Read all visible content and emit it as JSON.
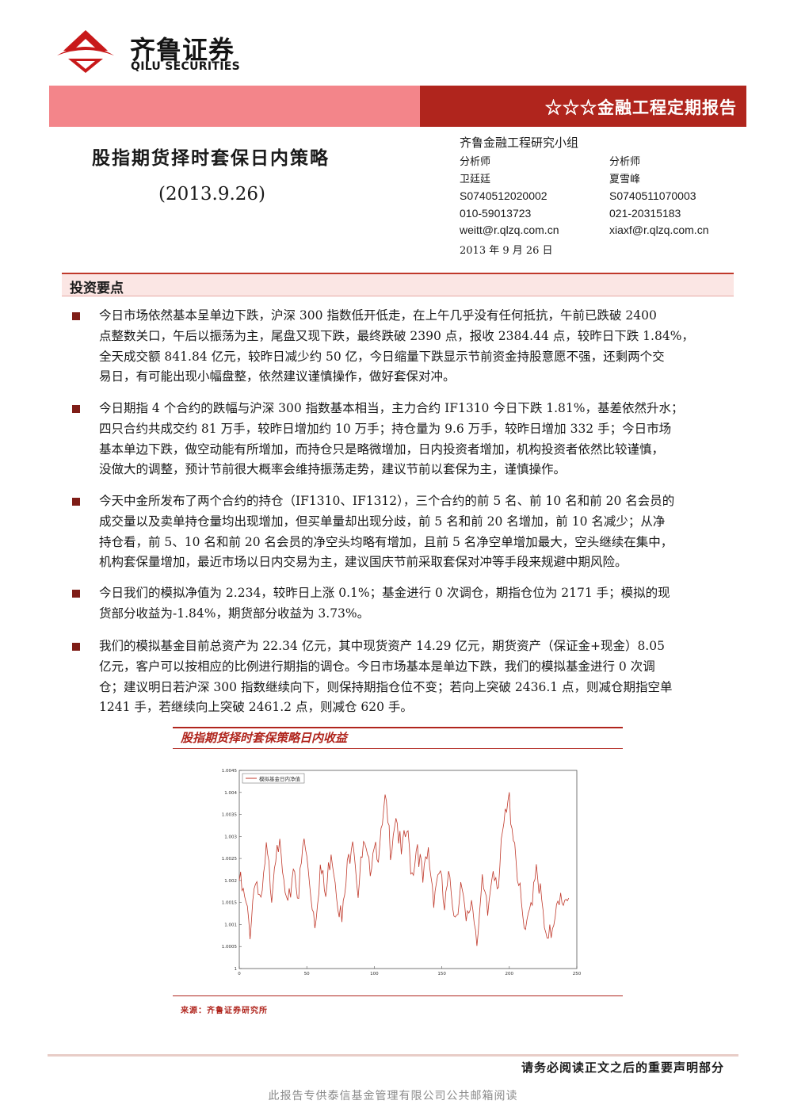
{
  "header": {
    "logo_cn": "齐鲁证券",
    "logo_en": "QILU SECURITIES",
    "banner": "☆☆☆金融工程定期报告"
  },
  "report": {
    "title": "股指期货择时套保日内策略",
    "date": "(2013.9.26)",
    "team": "齐鲁金融工程研究小组",
    "analysts": [
      {
        "role": "分析师",
        "name": "卫廷廷",
        "cert": "S0740512020002",
        "phone": "010-59013723",
        "email": "weitt@r.qlzq.com.cn"
      },
      {
        "role": "分析师",
        "name": "夏雪峰",
        "cert": "S0740511070003",
        "phone": "021-20315183",
        "email": "xiaxf@r.qlzq.com.cn"
      }
    ],
    "pub_date": "2013 年 9 月 26 日"
  },
  "section": {
    "title": "投资要点",
    "paragraphs": [
      [
        "今日市场依然基本呈单边下跌，沪深 300 指数低开低走，在上午几乎没有任何抵抗，午前已跌破 2400",
        "点整数关口，午后以振荡为主，尾盘又现下跌，最终跌破 2390 点，报收 2384.44 点，较昨日下跌 1.84%，",
        "全天成交额 841.84 亿元，较昨日减少约 50 亿，今日缩量下跌显示节前资金持股意愿不强，还剩两个交",
        "易日，有可能出现小幅盘整，依然建议谨慎操作，做好套保对冲。"
      ],
      [
        "今日期指 4 个合约的跌幅与沪深 300 指数基本相当，主力合约 IF1310 今日下跌 1.81%，基差依然升水；",
        "四只合约共成交约 81 万手，较昨日增加约 10 万手；持仓量为 9.6 万手，较昨日增加 332 手；今日市场",
        "基本单边下跌，做空动能有所增加，而持仓只是略微增加，日内投资者增加，机构投资者依然比较谨慎，",
        "没做大的调整，预计节前很大概率会维持振荡走势，建议节前以套保为主，谨慎操作。"
      ],
      [
        "今天中金所发布了两个合约的持仓（IF1310、IF1312），三个合约的前 5 名、前 10 名和前 20 名会员的",
        "成交量以及卖单持仓量均出现增加，但买单量却出现分歧，前 5 名和前 20 名增加，前 10 名减少；从净",
        "持仓看，前 5、10 名和前 20 名会员的净空头均略有增加，且前 5 名净空单增加最大，空头继续在集中，",
        "机构套保量增加，最近市场以日内交易为主，建议国庆节前采取套保对冲等手段来规避中期风险。"
      ],
      [
        "今日我们的模拟净值为 2.234，较昨日上涨 0.1%；基金进行 0 次调仓，期指仓位为 2171 手；模拟的现",
        "货部分收益为-1.84%，期货部分收益为 3.73%。"
      ],
      [
        "我们的模拟基金目前总资产为 22.34 亿元，其中现货资产 14.29 亿元，期货资产（保证金+现金）8.05",
        "亿元，客户可以按相应的比例进行期指的调仓。今日市场基本是单边下跌，我们的模拟基金进行 0 次调",
        "仓；建议明日若沪深 300 指数继续向下，则保持期指仓位不变；若向上突破 2436.1 点，则减仓期指空单",
        "1241 手，若继续向上突破 2461.2 点，则减仓 620 手。"
      ]
    ]
  },
  "chart": {
    "title": "股指期货择时套保策略日内收益",
    "source": "来源：齐鲁证券研究所"
  },
  "chart_data": {
    "type": "line",
    "legend": "模拟基金日内净值",
    "legend_position": "top-left",
    "xlim": [
      0,
      250
    ],
    "ylim": [
      1.0,
      1.0045
    ],
    "x_ticks": [
      "0",
      "50",
      "100",
      "150",
      "200",
      "250"
    ],
    "y_ticks": [
      "1",
      "1.0005",
      "1.001",
      "1.0015",
      "1.002",
      "1.0025",
      "1.003",
      "1.0035",
      "1.004",
      "1.0045"
    ],
    "color": "#c0392b",
    "series": [
      {
        "name": "模拟基金日内净值",
        "anchors": [
          [
            0,
            1.002
          ],
          [
            4,
            1.0015
          ],
          [
            8,
            1.0009
          ],
          [
            12,
            1.0022
          ],
          [
            16,
            1.0013
          ],
          [
            20,
            1.0026
          ],
          [
            24,
            1.0018
          ],
          [
            28,
            1.0031
          ],
          [
            32,
            1.0021
          ],
          [
            36,
            1.0012
          ],
          [
            40,
            1.0024
          ],
          [
            44,
            1.0017
          ],
          [
            48,
            1.0029
          ],
          [
            52,
            1.002
          ],
          [
            56,
            1.0011
          ],
          [
            60,
            1.0023
          ],
          [
            64,
            1.0016
          ],
          [
            68,
            1.0028
          ],
          [
            72,
            1.0019
          ],
          [
            76,
            1.001
          ],
          [
            80,
            1.0022
          ],
          [
            84,
            1.0032
          ],
          [
            88,
            1.0018
          ],
          [
            92,
            1.0027
          ],
          [
            96,
            1.0022
          ],
          [
            100,
            1.003
          ],
          [
            104,
            1.0026
          ],
          [
            108,
            1.0037
          ],
          [
            112,
            1.0028
          ],
          [
            116,
            1.0036
          ],
          [
            120,
            1.0025
          ],
          [
            124,
            1.0031
          ],
          [
            128,
            1.0022
          ],
          [
            132,
            1.0029
          ],
          [
            136,
            1.0019
          ],
          [
            140,
            1.0026
          ],
          [
            144,
            1.0017
          ],
          [
            148,
            1.0023
          ],
          [
            152,
            1.0013
          ],
          [
            156,
            1.0021
          ],
          [
            160,
            1.0012
          ],
          [
            164,
            1.0019
          ],
          [
            168,
            1.0009
          ],
          [
            172,
            1.0016
          ],
          [
            176,
            1.0008
          ],
          [
            180,
            1.0018
          ],
          [
            184,
            1.0012
          ],
          [
            188,
            1.0024
          ],
          [
            192,
            1.002
          ],
          [
            196,
            1.0032
          ],
          [
            200,
            1.0038
          ],
          [
            204,
            1.0029
          ],
          [
            208,
            1.0016
          ],
          [
            212,
            1.0006
          ],
          [
            216,
            1.0015
          ],
          [
            220,
            1.0025
          ],
          [
            224,
            1.0014
          ],
          [
            228,
            1.0004
          ],
          [
            232,
            1.001
          ],
          [
            236,
            1.0018
          ],
          [
            240,
            1.0012
          ],
          [
            244,
            1.0016
          ]
        ]
      }
    ]
  },
  "footer": {
    "notice": "请务必阅读正文之后的重要声明部分",
    "watermark": "此报告专供泰信基金管理有限公司公共邮箱阅读"
  }
}
